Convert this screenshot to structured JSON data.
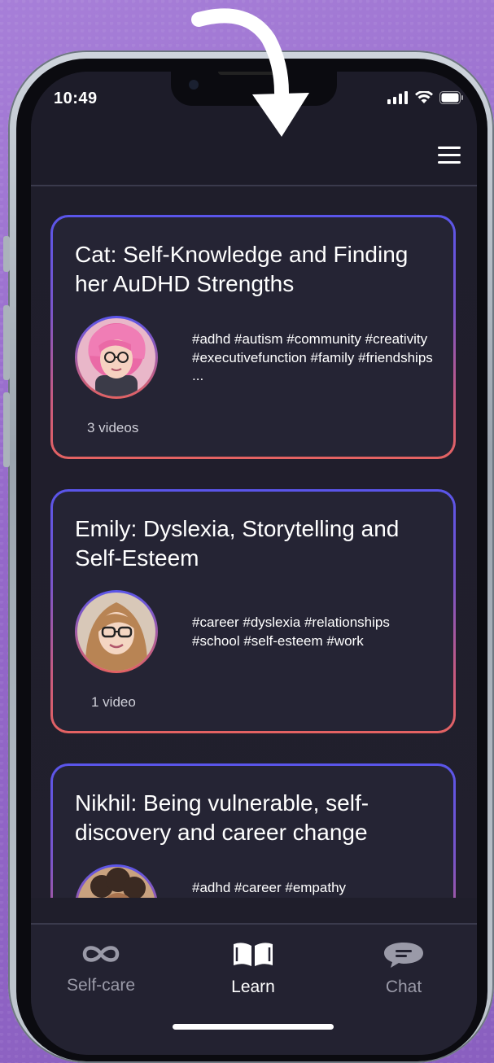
{
  "status_bar": {
    "time": "10:49"
  },
  "cards": [
    {
      "title": "Cat: Self-Knowledge and Finding her AuDHD Strengths",
      "tags": "#adhd #autism #community #creativity #executivefunction #family #friendships ...",
      "video_count": "3 videos"
    },
    {
      "title": "Emily: Dyslexia, Storytelling and Self-Esteem",
      "tags": "#career #dyslexia #relationships #school #self-esteem #work",
      "video_count": "1 video"
    },
    {
      "title": "Nikhil: Being vulnerable, self-discovery and career change",
      "tags": "#adhd #career #empathy",
      "video_count": ""
    }
  ],
  "bottom_nav": {
    "items": [
      {
        "label": "Self-care",
        "icon": "infinity-icon",
        "active": false
      },
      {
        "label": "Learn",
        "icon": "book-icon",
        "active": true
      },
      {
        "label": "Chat",
        "icon": "chat-bubble-icon",
        "active": false
      }
    ]
  },
  "colors": {
    "background": "#9468c9",
    "screen": "#1f1e2b",
    "card": "#252434",
    "border_top": "#5a55ea",
    "border_bottom": "#e46262",
    "nav_inactive": "#9a9aa8",
    "nav_active": "#ffffff"
  }
}
